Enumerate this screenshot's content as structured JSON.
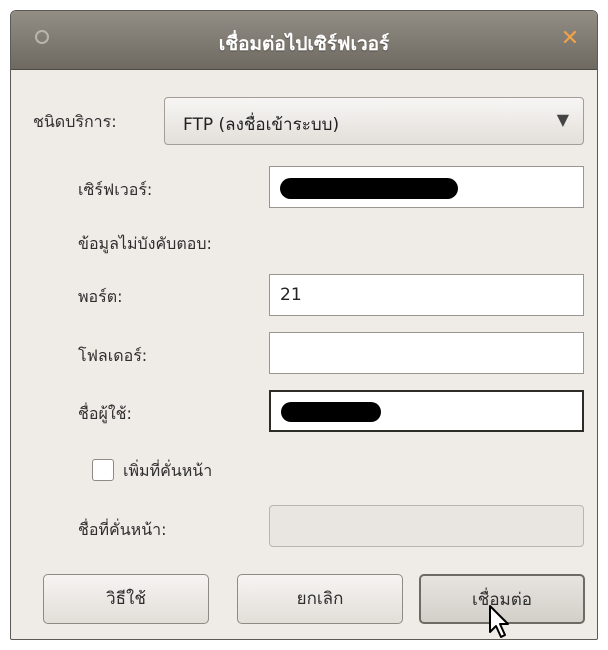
{
  "window": {
    "title": "เชื่อมต่อไปเซิร์ฟเวอร์"
  },
  "service": {
    "label": "ชนิดบริการ:",
    "value": "FTP (ลงชื่อเข้าระบบ)"
  },
  "server": {
    "label": "เซิร์ฟเวอร์:",
    "value_redacted": true
  },
  "optional_heading": "ข้อมูลไม่บังคับตอบ:",
  "port": {
    "label": "พอร์ต:",
    "value": "21"
  },
  "folder": {
    "label": "โฟลเดอร์:",
    "value": ""
  },
  "username": {
    "label": "ชื่อผู้ใช้:",
    "value_redacted": true
  },
  "bookmark": {
    "checkbox_label": "เพิ่มที่คั่นหน้า",
    "checked": false,
    "name_label": "ชื่อที่คั่นหน้า:",
    "name_value": ""
  },
  "buttons": {
    "help": "วิธีใช้",
    "cancel": "ยกเลิก",
    "connect": "เชื่อมต่อ"
  },
  "icons": {
    "close": "close-icon",
    "window_menu": "window-menu-icon",
    "dropdown": "chevron-down-icon",
    "pointer": "mouse-pointer-icon"
  },
  "colors": {
    "titlebar": "#7e7970",
    "close_accent": "#f0a24a",
    "dialog_bg": "#efebe7"
  }
}
